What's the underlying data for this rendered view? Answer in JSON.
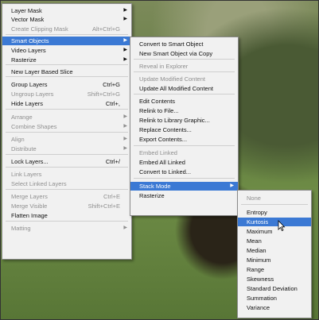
{
  "menu1": {
    "items": [
      {
        "label": "Layer Mask",
        "shortcut": "",
        "sub": true,
        "disabled": false
      },
      {
        "label": "Vector Mask",
        "shortcut": "",
        "sub": true,
        "disabled": false
      },
      {
        "label": "Create Clipping Mask",
        "shortcut": "Alt+Ctrl+G",
        "sub": false,
        "disabled": true
      },
      {
        "label": "Smart Objects",
        "shortcut": "",
        "sub": true,
        "disabled": false,
        "highlight": true
      },
      {
        "label": "Video Layers",
        "shortcut": "",
        "sub": true,
        "disabled": false
      },
      {
        "label": "Rasterize",
        "shortcut": "",
        "sub": true,
        "disabled": false
      },
      {
        "label": "New Layer Based Slice",
        "shortcut": "",
        "sub": false,
        "disabled": false
      },
      {
        "label": "Group Layers",
        "shortcut": "Ctrl+G",
        "sub": false,
        "disabled": false
      },
      {
        "label": "Ungroup Layers",
        "shortcut": "Shift+Ctrl+G",
        "sub": false,
        "disabled": true
      },
      {
        "label": "Hide Layers",
        "shortcut": "Ctrl+,",
        "sub": false,
        "disabled": false
      },
      {
        "label": "Arrange",
        "shortcut": "",
        "sub": true,
        "disabled": true
      },
      {
        "label": "Combine Shapes",
        "shortcut": "",
        "sub": true,
        "disabled": true
      },
      {
        "label": "Align",
        "shortcut": "",
        "sub": true,
        "disabled": true
      },
      {
        "label": "Distribute",
        "shortcut": "",
        "sub": true,
        "disabled": true
      },
      {
        "label": "Lock Layers...",
        "shortcut": "Ctrl+/",
        "sub": false,
        "disabled": false
      },
      {
        "label": "Link Layers",
        "shortcut": "",
        "sub": false,
        "disabled": true
      },
      {
        "label": "Select Linked Layers",
        "shortcut": "",
        "sub": false,
        "disabled": true
      },
      {
        "label": "Merge Layers",
        "shortcut": "Ctrl+E",
        "sub": false,
        "disabled": true
      },
      {
        "label": "Merge Visible",
        "shortcut": "Shift+Ctrl+E",
        "sub": false,
        "disabled": true
      },
      {
        "label": "Flatten Image",
        "shortcut": "",
        "sub": false,
        "disabled": false
      },
      {
        "label": "Matting",
        "shortcut": "",
        "sub": true,
        "disabled": true
      }
    ]
  },
  "menu2": {
    "items": [
      {
        "label": "Convert to Smart Object",
        "disabled": false
      },
      {
        "label": "New Smart Object via Copy",
        "disabled": false
      },
      {
        "label": "Reveal in Explorer",
        "disabled": true
      },
      {
        "label": "Update Modified Content",
        "disabled": true
      },
      {
        "label": "Update All Modified Content",
        "disabled": false
      },
      {
        "label": "Edit Contents",
        "disabled": false
      },
      {
        "label": "Relink to File...",
        "disabled": false
      },
      {
        "label": "Relink to Library Graphic...",
        "disabled": false
      },
      {
        "label": "Replace Contents...",
        "disabled": false
      },
      {
        "label": "Export Contents...",
        "disabled": false
      },
      {
        "label": "Embed Linked",
        "disabled": true
      },
      {
        "label": "Embed All Linked",
        "disabled": false
      },
      {
        "label": "Convert to Linked...",
        "disabled": false
      },
      {
        "label": "Stack Mode",
        "disabled": false,
        "sub": true,
        "highlight": true
      },
      {
        "label": "Rasterize",
        "disabled": false
      }
    ]
  },
  "menu3": {
    "items": [
      {
        "label": "None",
        "disabled": true
      },
      {
        "label": "Entropy",
        "disabled": false
      },
      {
        "label": "Kurtosis",
        "disabled": false,
        "highlight": true
      },
      {
        "label": "Maximum",
        "disabled": false
      },
      {
        "label": "Mean",
        "disabled": false
      },
      {
        "label": "Median",
        "disabled": false
      },
      {
        "label": "Minimum",
        "disabled": false
      },
      {
        "label": "Range",
        "disabled": false
      },
      {
        "label": "Skewness",
        "disabled": false
      },
      {
        "label": "Standard Deviation",
        "disabled": false
      },
      {
        "label": "Summation",
        "disabled": false
      },
      {
        "label": "Variance",
        "disabled": false
      }
    ]
  },
  "colors": {
    "highlight": "#3b79d4",
    "menu_bg": "#f1f1f1",
    "disabled_text": "#8f8f8f"
  }
}
